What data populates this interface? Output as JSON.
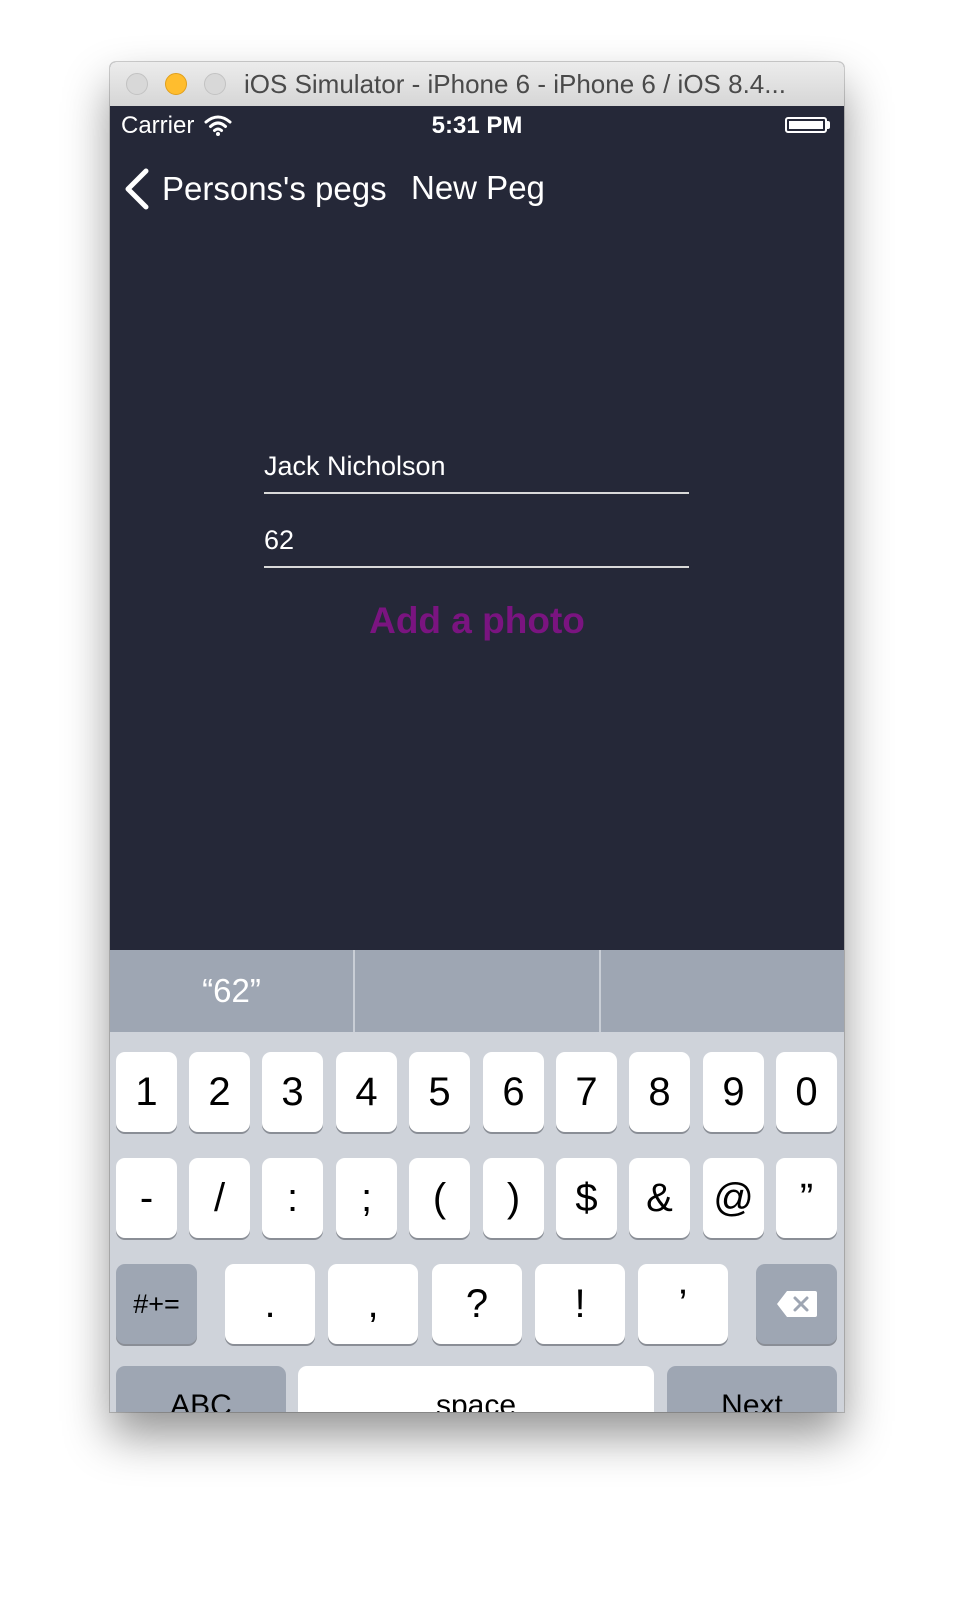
{
  "window": {
    "title": "iOS Simulator - iPhone 6 - iPhone 6 / iOS 8.4..."
  },
  "status_bar": {
    "carrier": "Carrier",
    "time": "5:31 PM"
  },
  "nav": {
    "back_label": "Persons's pegs",
    "title": "New Peg"
  },
  "form": {
    "name_value": "Jack Nicholson",
    "age_value": "62",
    "add_photo_label": "Add a photo",
    "add_photo_color": "#7a1480"
  },
  "keyboard": {
    "suggestions": [
      "“62”",
      "",
      ""
    ],
    "row1": [
      "1",
      "2",
      "3",
      "4",
      "5",
      "6",
      "7",
      "8",
      "9",
      "0"
    ],
    "row2": [
      "-",
      "/",
      ":",
      ";",
      "(",
      ")",
      "$",
      "&",
      "@",
      "”"
    ],
    "row3_toggle": "#+=",
    "row3": [
      ".",
      ",",
      "?",
      "!",
      "’"
    ],
    "mode_key": "ABC",
    "space_key": "space",
    "return_key": "Next"
  },
  "colors": {
    "screen_background": "#252838",
    "keyboard_background": "#cfd3da",
    "special_key": "#9ea6b3"
  },
  "icons": {
    "wifi": "wifi-icon",
    "battery": "battery-icon",
    "back": "back-chevron-icon",
    "delete": "backspace-icon"
  }
}
